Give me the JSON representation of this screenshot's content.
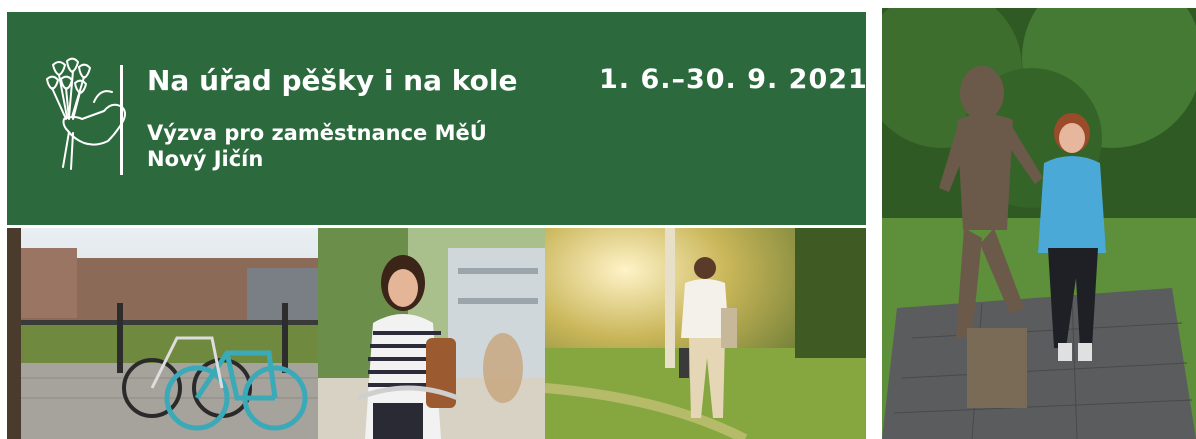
{
  "banner": {
    "title": "Na úřad pěšky i na kole",
    "subtitle_line1": "Výzva pro zaměstnance MěÚ",
    "subtitle_line2": "Nový Jičín",
    "date_range": "1. 6.–30. 9. 2021",
    "background_color": "#2c6a3e",
    "logo_icon": "bouquet-hand-icon"
  },
  "photos": [
    {
      "name": "bicycles-parked-photo"
    },
    {
      "name": "woman-on-bicycle-photo"
    },
    {
      "name": "man-walking-park-photo"
    },
    {
      "name": "woman-running-with-statue-photo"
    }
  ]
}
